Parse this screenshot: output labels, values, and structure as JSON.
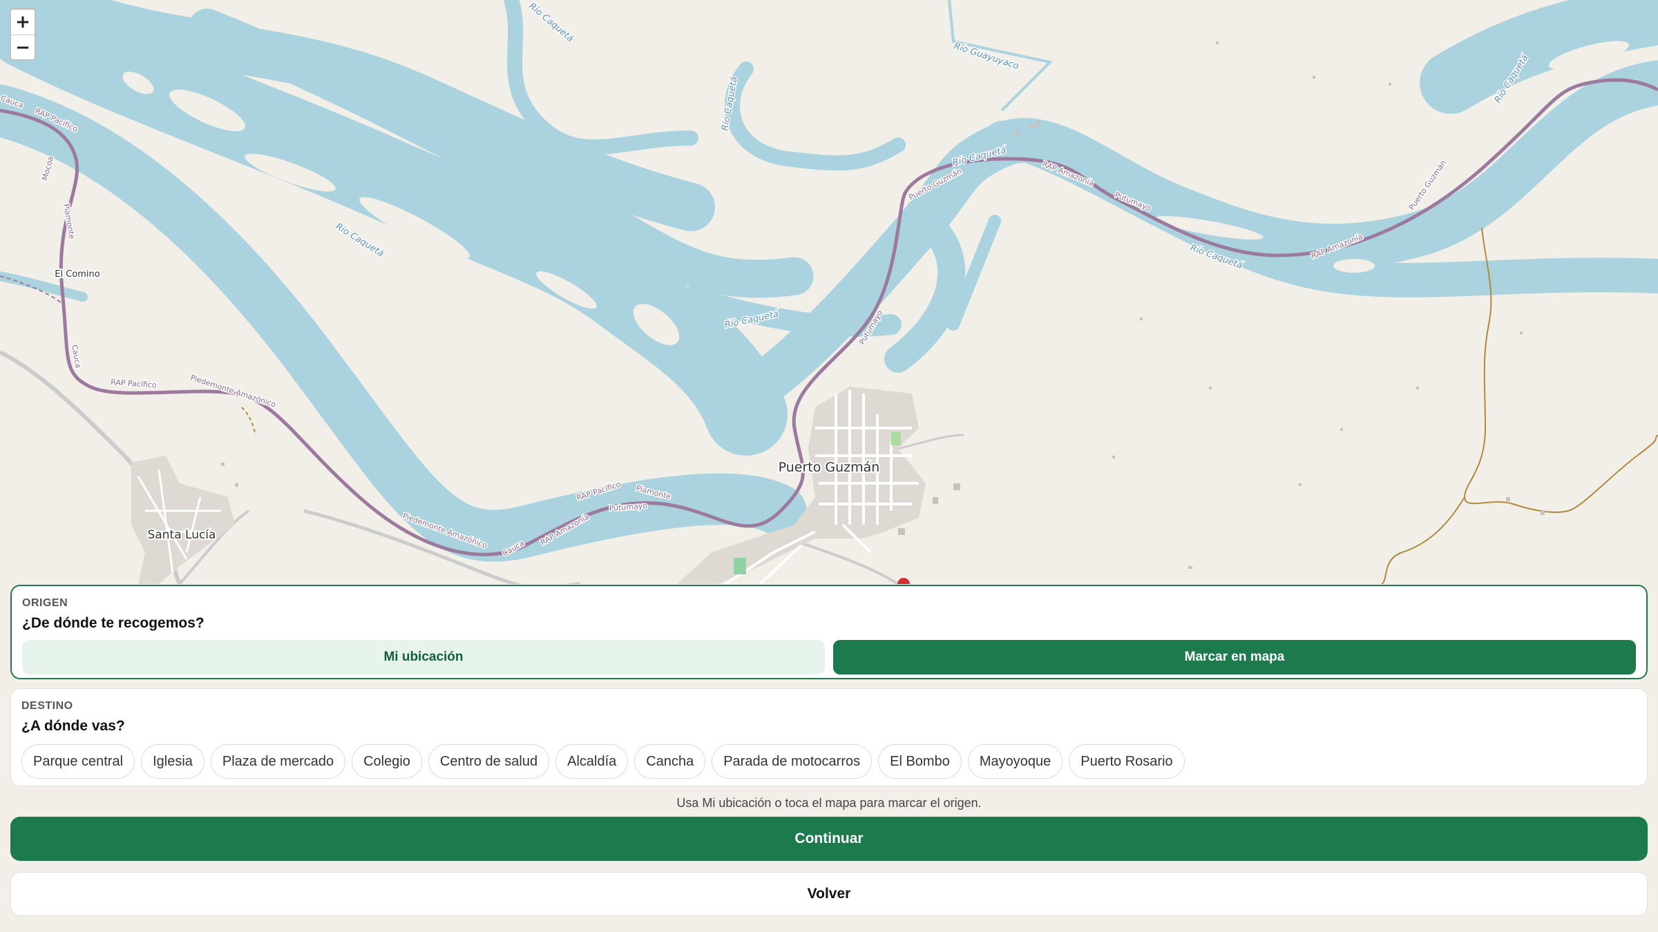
{
  "map": {
    "zoom_in": "+",
    "zoom_out": "−",
    "labels": {
      "puerto_guzman": "Puerto Guzmán",
      "santa_lucia": "Santa Lucía",
      "el_comino": "El Comino",
      "rio_caqueta": "Río Caquetá",
      "rio_guayuyaco": "Río Guayuyaco",
      "rap_pacifico": "RAP Pacífico",
      "rap_amazonia": "RAP Amazonía",
      "piedemonte_amazonico": "Piedemonte Amazónico",
      "putumayo": "Putumayo",
      "piamonte": "Piamonte",
      "cauca": "Cauca",
      "mocoa": "Mocoa"
    },
    "colors": {
      "water": "#aad3df",
      "land": "#f2efe9",
      "road": "#9b7a9e",
      "path": "#b08a3c",
      "town": "#ded9d3"
    }
  },
  "origin": {
    "kicker": "ORIGEN",
    "question": "¿De dónde te recogemos?",
    "my_location": "Mi ubicación",
    "mark_on_map": "Marcar en mapa"
  },
  "destination": {
    "kicker": "DESTINO",
    "question": "¿A dónde vas?",
    "places": [
      "Parque central",
      "Iglesia",
      "Plaza de mercado",
      "Colegio",
      "Centro de salud",
      "Alcaldía",
      "Cancha",
      "Parada de motocarros",
      "El Bombo",
      "Mayoyoque",
      "Puerto Rosario"
    ]
  },
  "hint": "Usa Mi ubicación o toca el mapa para marcar el origen.",
  "continue_label": "Continuar",
  "back_label": "Volver",
  "colors": {
    "accent": "#1c7a4d",
    "accent_light": "#e6f4ec"
  }
}
